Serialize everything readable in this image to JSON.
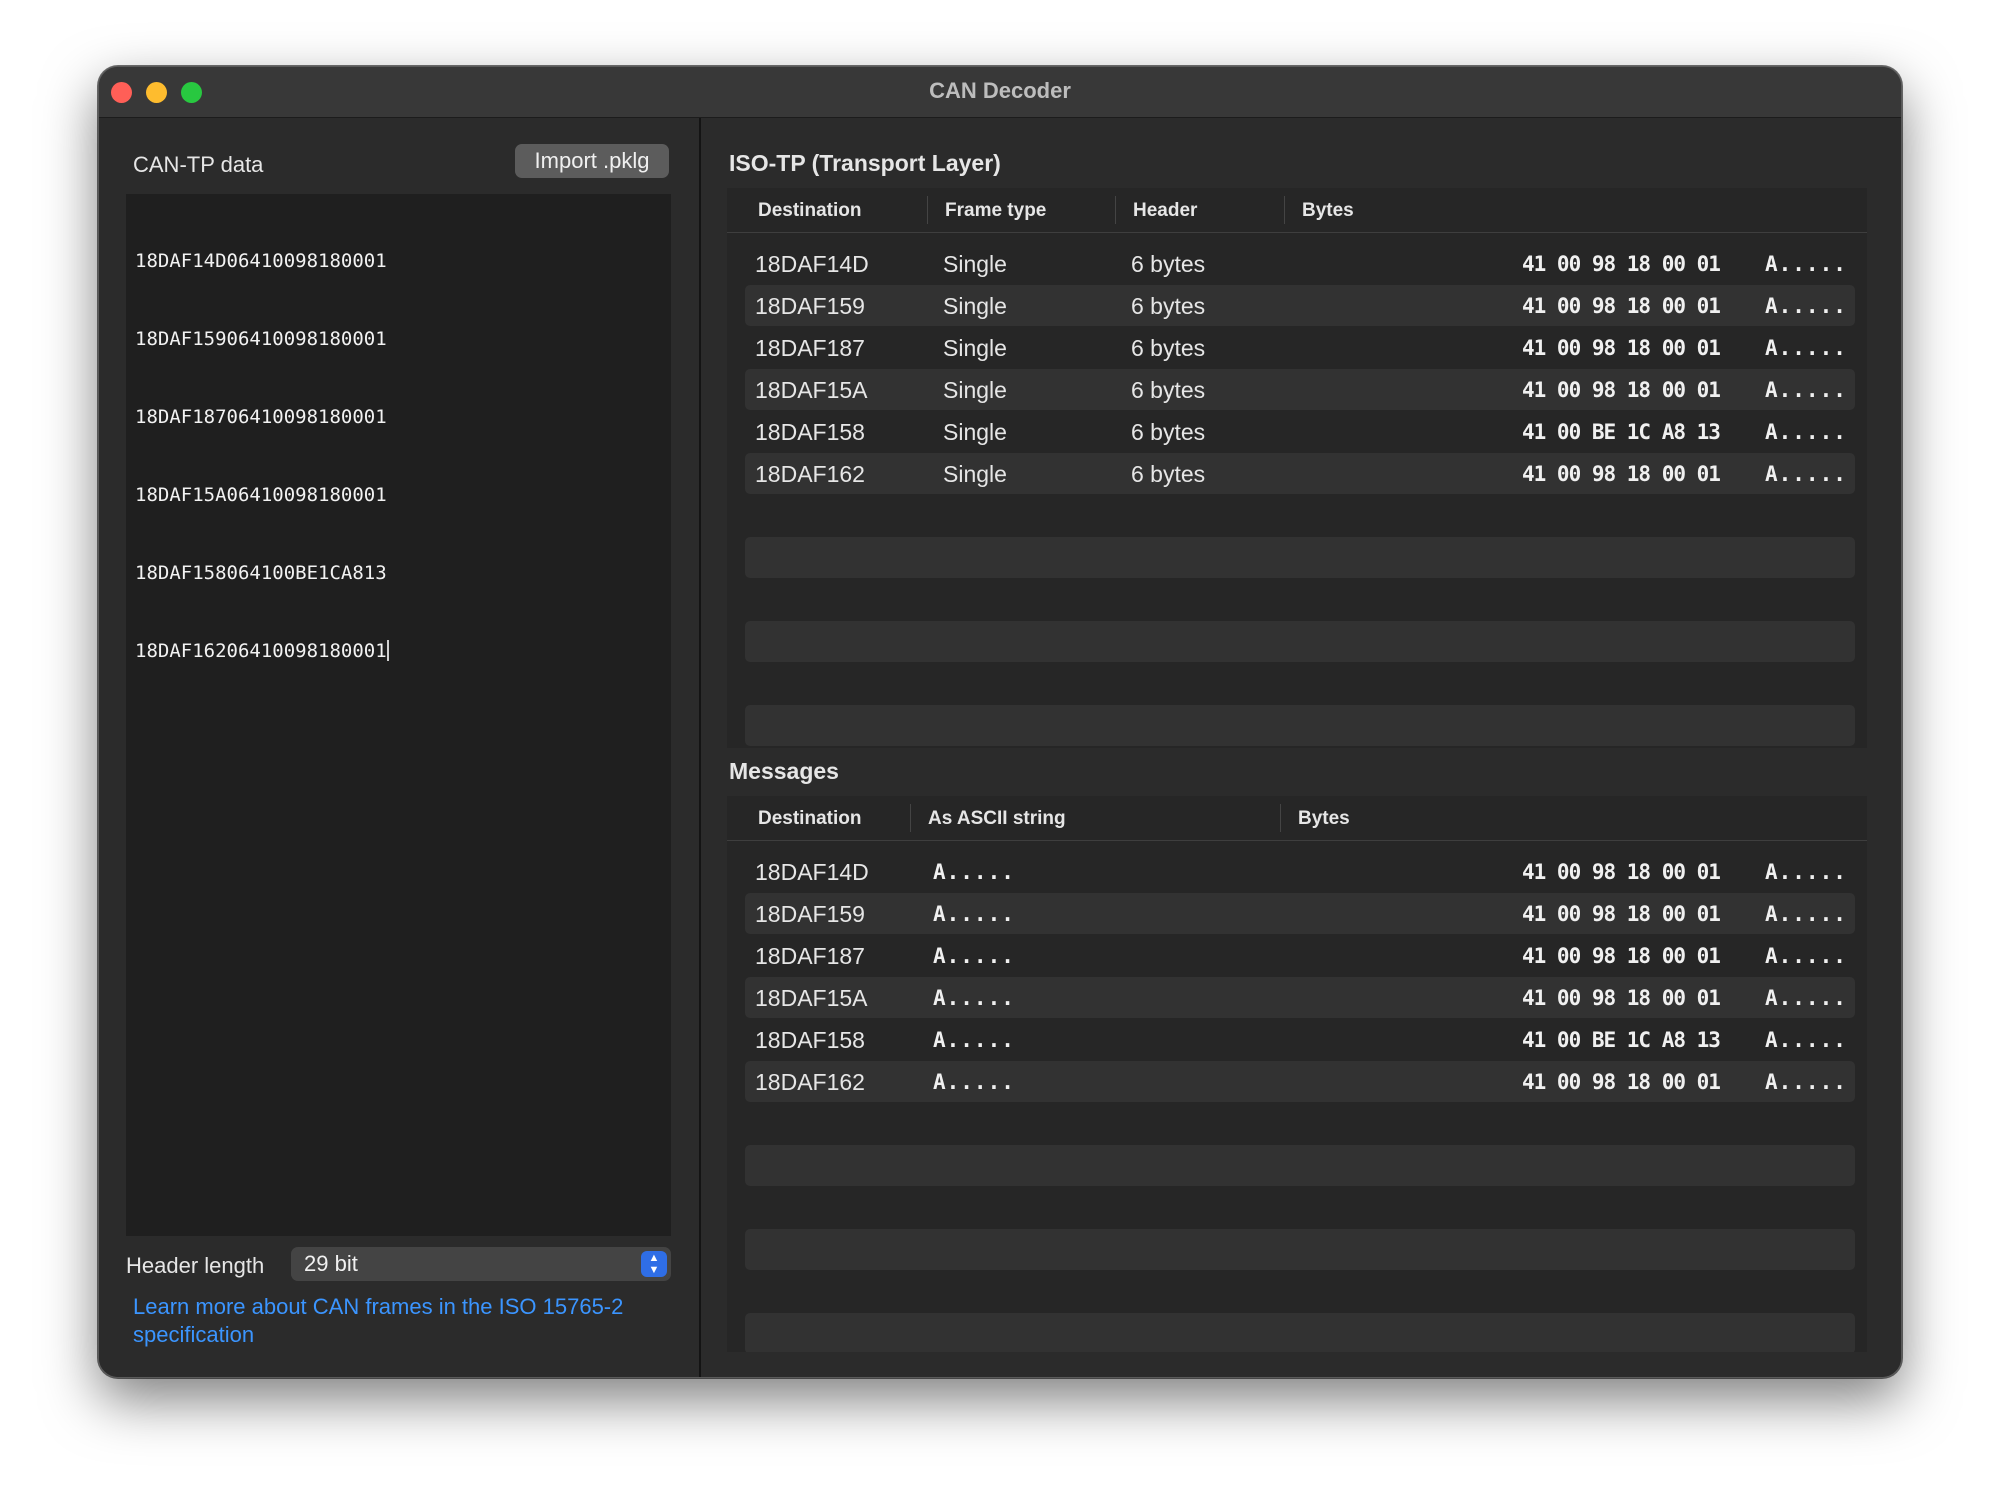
{
  "window": {
    "title": "CAN Decoder"
  },
  "input_panel": {
    "label": "CAN-TP data",
    "import_button": "Import .pklg",
    "lines": [
      "18DAF14D06410098180001",
      "18DAF15906410098180001",
      "18DAF18706410098180001",
      "18DAF15A06410098180001",
      "18DAF158064100BE1CA813",
      "18DAF16206410098180001"
    ],
    "header_length_label": "Header length",
    "header_length_value": "29 bit",
    "link_text": "Learn more about CAN frames in the ISO 15765-2 specification"
  },
  "isotp": {
    "title": "ISO-TP (Transport Layer)",
    "columns": [
      "Destination",
      "Frame type",
      "Header",
      "Bytes"
    ],
    "rows": [
      {
        "destination": "18DAF14D",
        "frame_type": "Single",
        "header": "6 bytes",
        "bytes": "41 00 98 18 00 01",
        "ascii": "A....."
      },
      {
        "destination": "18DAF159",
        "frame_type": "Single",
        "header": "6 bytes",
        "bytes": "41 00 98 18 00 01",
        "ascii": "A....."
      },
      {
        "destination": "18DAF187",
        "frame_type": "Single",
        "header": "6 bytes",
        "bytes": "41 00 98 18 00 01",
        "ascii": "A....."
      },
      {
        "destination": "18DAF15A",
        "frame_type": "Single",
        "header": "6 bytes",
        "bytes": "41 00 98 18 00 01",
        "ascii": "A....."
      },
      {
        "destination": "18DAF158",
        "frame_type": "Single",
        "header": "6 bytes",
        "bytes": "41 00 BE 1C A8 13",
        "ascii": "A....."
      },
      {
        "destination": "18DAF162",
        "frame_type": "Single",
        "header": "6 bytes",
        "bytes": "41 00 98 18 00 01",
        "ascii": "A....."
      }
    ]
  },
  "messages": {
    "title": "Messages",
    "columns": [
      "Destination",
      "As ASCII string",
      "Bytes"
    ],
    "rows": [
      {
        "destination": "18DAF14D",
        "ascii_string": "A.....",
        "bytes": "41 00 98 18 00 01",
        "ascii": "A....."
      },
      {
        "destination": "18DAF159",
        "ascii_string": "A.....",
        "bytes": "41 00 98 18 00 01",
        "ascii": "A....."
      },
      {
        "destination": "18DAF187",
        "ascii_string": "A.....",
        "bytes": "41 00 98 18 00 01",
        "ascii": "A....."
      },
      {
        "destination": "18DAF15A",
        "ascii_string": "A.....",
        "bytes": "41 00 98 18 00 01",
        "ascii": "A....."
      },
      {
        "destination": "18DAF158",
        "ascii_string": "A.....",
        "bytes": "41 00 BE 1C A8 13",
        "ascii": "A....."
      },
      {
        "destination": "18DAF162",
        "ascii_string": "A.....",
        "bytes": "41 00 98 18 00 01",
        "ascii": "A....."
      }
    ]
  },
  "colors": {
    "window_bg": "#2b2b2b",
    "table_bg": "#262626",
    "row_alt": "#323232",
    "link": "#3b95ff",
    "popup_accent": "#2f6ee6",
    "close": "#ff5f57",
    "minimize": "#febc2e",
    "zoom": "#28c840"
  }
}
